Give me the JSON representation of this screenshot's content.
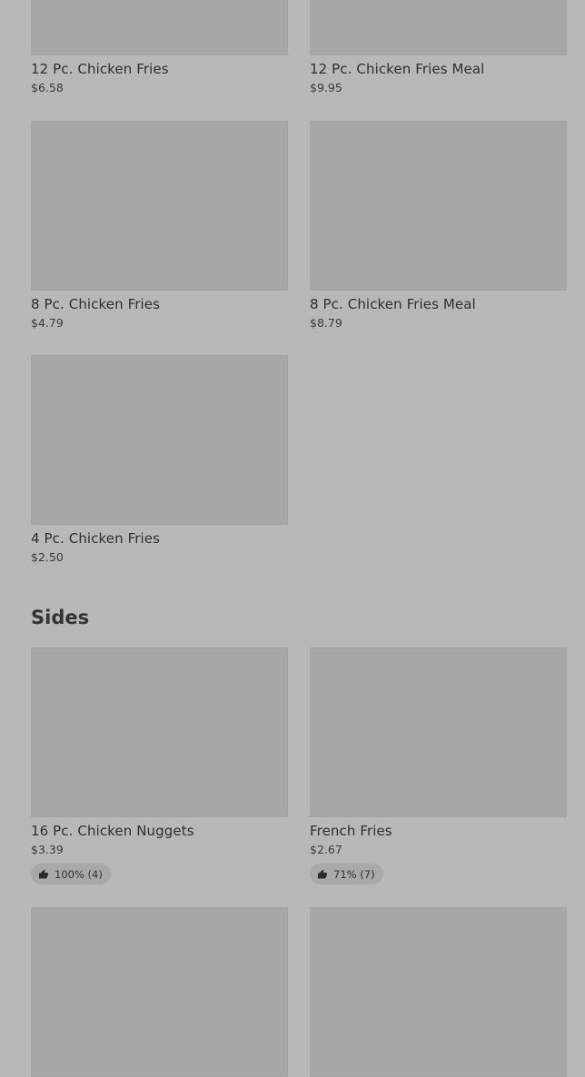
{
  "top_items": [
    {
      "name": "12 Pc. Chicken Fries",
      "price": "$6.58"
    },
    {
      "name": "12 Pc. Chicken Fries Meal",
      "price": "$9.95"
    },
    {
      "name": "8 Pc. Chicken Fries",
      "price": "$4.79"
    },
    {
      "name": "8 Pc. Chicken Fries Meal",
      "price": "$8.79"
    },
    {
      "name": "4 Pc. Chicken Fries",
      "price": "$2.50"
    }
  ],
  "sides": {
    "title": "Sides",
    "items": [
      {
        "name": "16 Pc. Chicken Nuggets",
        "price": "$3.39",
        "rating": "100% (4)"
      },
      {
        "name": "French Fries",
        "price": "$2.67",
        "rating": "71% (7)"
      }
    ]
  },
  "icons": {
    "rating": "thumbs-up-icon"
  }
}
